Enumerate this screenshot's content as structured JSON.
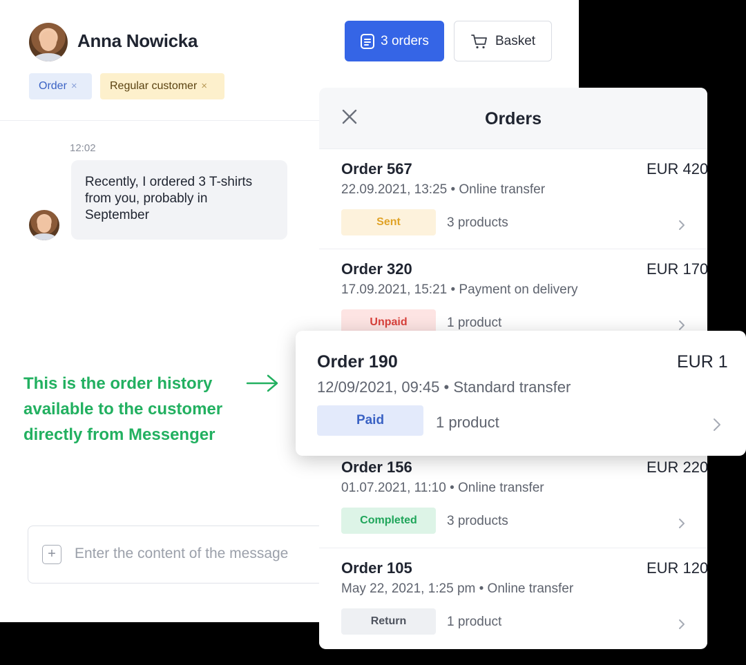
{
  "customer": {
    "name": "Anna Nowicka",
    "tags": [
      {
        "label": "Order",
        "remove": "×"
      },
      {
        "label": "Regular customer",
        "remove": "×"
      }
    ]
  },
  "header_actions": {
    "orders_label": "3 orders",
    "basket_label": "Basket",
    "orders_icon": "document-icon",
    "basket_icon": "cart-icon"
  },
  "chat": {
    "time": "12:02",
    "message": "Recently, I ordered 3 T-shirts from you, probably in September"
  },
  "promo_text": "This is the order history available to the customer directly from Messenger",
  "composer": {
    "placeholder": "Enter the content of the message",
    "plus": "+"
  },
  "orders_panel": {
    "title": "Orders",
    "orders": [
      {
        "name": "Order 567",
        "amount": "EUR 420",
        "meta": "22.09.2021, 13:25 • Online transfer",
        "status": "Sent",
        "count": "3 products"
      },
      {
        "name": "Order 320",
        "amount": "EUR 170",
        "meta": "17.09.2021, 15:21 • Payment on delivery",
        "status": "Unpaid",
        "count": "1 product"
      },
      {
        "name": "Order 190",
        "amount": "EUR 1",
        "meta": "12/09/2021, 09:45 • Standard transfer",
        "status": "Paid",
        "count": "1 product"
      },
      {
        "name": "Order 156",
        "amount": "EUR 220",
        "meta": "01.07.2021, 11:10 • Online transfer",
        "status": "Completed",
        "count": "3 products"
      },
      {
        "name": "Order 105",
        "amount": "EUR 120",
        "meta": "May 22, 2021, 1:25 pm • Online transfer",
        "status": "Return",
        "count": "1 product"
      }
    ]
  },
  "colors": {
    "primary": "#3565e6",
    "accent_green": "#22b060",
    "sent": "#e0a327",
    "unpaid": "#d9413b",
    "paid": "#3a62c4",
    "completed": "#1fa55a"
  }
}
